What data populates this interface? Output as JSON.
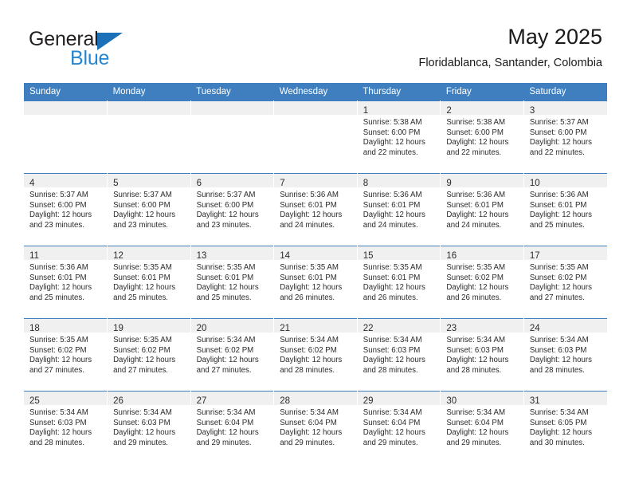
{
  "brand": {
    "name_part1": "General",
    "name_part2": "Blue",
    "triangle_color": "#1c70b8",
    "blue_color": "#2485d0"
  },
  "header": {
    "title": "May 2025",
    "subtitle": "Floridablanca, Santander, Colombia"
  },
  "theme": {
    "header_bg": "#3f7fbf",
    "daynum_bg": "#f0f0f0",
    "cell_bg": "#ffffff",
    "text": "#2b2b2b"
  },
  "calendar": {
    "day_headers": [
      "Sunday",
      "Monday",
      "Tuesday",
      "Wednesday",
      "Thursday",
      "Friday",
      "Saturday"
    ],
    "weeks": [
      [
        {
          "day": "",
          "sunrise": "",
          "sunset": "",
          "daylight_line1": "",
          "daylight_line2": ""
        },
        {
          "day": "",
          "sunrise": "",
          "sunset": "",
          "daylight_line1": "",
          "daylight_line2": ""
        },
        {
          "day": "",
          "sunrise": "",
          "sunset": "",
          "daylight_line1": "",
          "daylight_line2": ""
        },
        {
          "day": "",
          "sunrise": "",
          "sunset": "",
          "daylight_line1": "",
          "daylight_line2": ""
        },
        {
          "day": "1",
          "sunrise": "Sunrise: 5:38 AM",
          "sunset": "Sunset: 6:00 PM",
          "daylight_line1": "Daylight: 12 hours",
          "daylight_line2": "and 22 minutes."
        },
        {
          "day": "2",
          "sunrise": "Sunrise: 5:38 AM",
          "sunset": "Sunset: 6:00 PM",
          "daylight_line1": "Daylight: 12 hours",
          "daylight_line2": "and 22 minutes."
        },
        {
          "day": "3",
          "sunrise": "Sunrise: 5:37 AM",
          "sunset": "Sunset: 6:00 PM",
          "daylight_line1": "Daylight: 12 hours",
          "daylight_line2": "and 22 minutes."
        }
      ],
      [
        {
          "day": "4",
          "sunrise": "Sunrise: 5:37 AM",
          "sunset": "Sunset: 6:00 PM",
          "daylight_line1": "Daylight: 12 hours",
          "daylight_line2": "and 23 minutes."
        },
        {
          "day": "5",
          "sunrise": "Sunrise: 5:37 AM",
          "sunset": "Sunset: 6:00 PM",
          "daylight_line1": "Daylight: 12 hours",
          "daylight_line2": "and 23 minutes."
        },
        {
          "day": "6",
          "sunrise": "Sunrise: 5:37 AM",
          "sunset": "Sunset: 6:00 PM",
          "daylight_line1": "Daylight: 12 hours",
          "daylight_line2": "and 23 minutes."
        },
        {
          "day": "7",
          "sunrise": "Sunrise: 5:36 AM",
          "sunset": "Sunset: 6:01 PM",
          "daylight_line1": "Daylight: 12 hours",
          "daylight_line2": "and 24 minutes."
        },
        {
          "day": "8",
          "sunrise": "Sunrise: 5:36 AM",
          "sunset": "Sunset: 6:01 PM",
          "daylight_line1": "Daylight: 12 hours",
          "daylight_line2": "and 24 minutes."
        },
        {
          "day": "9",
          "sunrise": "Sunrise: 5:36 AM",
          "sunset": "Sunset: 6:01 PM",
          "daylight_line1": "Daylight: 12 hours",
          "daylight_line2": "and 24 minutes."
        },
        {
          "day": "10",
          "sunrise": "Sunrise: 5:36 AM",
          "sunset": "Sunset: 6:01 PM",
          "daylight_line1": "Daylight: 12 hours",
          "daylight_line2": "and 25 minutes."
        }
      ],
      [
        {
          "day": "11",
          "sunrise": "Sunrise: 5:36 AM",
          "sunset": "Sunset: 6:01 PM",
          "daylight_line1": "Daylight: 12 hours",
          "daylight_line2": "and 25 minutes."
        },
        {
          "day": "12",
          "sunrise": "Sunrise: 5:35 AM",
          "sunset": "Sunset: 6:01 PM",
          "daylight_line1": "Daylight: 12 hours",
          "daylight_line2": "and 25 minutes."
        },
        {
          "day": "13",
          "sunrise": "Sunrise: 5:35 AM",
          "sunset": "Sunset: 6:01 PM",
          "daylight_line1": "Daylight: 12 hours",
          "daylight_line2": "and 25 minutes."
        },
        {
          "day": "14",
          "sunrise": "Sunrise: 5:35 AM",
          "sunset": "Sunset: 6:01 PM",
          "daylight_line1": "Daylight: 12 hours",
          "daylight_line2": "and 26 minutes."
        },
        {
          "day": "15",
          "sunrise": "Sunrise: 5:35 AM",
          "sunset": "Sunset: 6:01 PM",
          "daylight_line1": "Daylight: 12 hours",
          "daylight_line2": "and 26 minutes."
        },
        {
          "day": "16",
          "sunrise": "Sunrise: 5:35 AM",
          "sunset": "Sunset: 6:02 PM",
          "daylight_line1": "Daylight: 12 hours",
          "daylight_line2": "and 26 minutes."
        },
        {
          "day": "17",
          "sunrise": "Sunrise: 5:35 AM",
          "sunset": "Sunset: 6:02 PM",
          "daylight_line1": "Daylight: 12 hours",
          "daylight_line2": "and 27 minutes."
        }
      ],
      [
        {
          "day": "18",
          "sunrise": "Sunrise: 5:35 AM",
          "sunset": "Sunset: 6:02 PM",
          "daylight_line1": "Daylight: 12 hours",
          "daylight_line2": "and 27 minutes."
        },
        {
          "day": "19",
          "sunrise": "Sunrise: 5:35 AM",
          "sunset": "Sunset: 6:02 PM",
          "daylight_line1": "Daylight: 12 hours",
          "daylight_line2": "and 27 minutes."
        },
        {
          "day": "20",
          "sunrise": "Sunrise: 5:34 AM",
          "sunset": "Sunset: 6:02 PM",
          "daylight_line1": "Daylight: 12 hours",
          "daylight_line2": "and 27 minutes."
        },
        {
          "day": "21",
          "sunrise": "Sunrise: 5:34 AM",
          "sunset": "Sunset: 6:02 PM",
          "daylight_line1": "Daylight: 12 hours",
          "daylight_line2": "and 28 minutes."
        },
        {
          "day": "22",
          "sunrise": "Sunrise: 5:34 AM",
          "sunset": "Sunset: 6:03 PM",
          "daylight_line1": "Daylight: 12 hours",
          "daylight_line2": "and 28 minutes."
        },
        {
          "day": "23",
          "sunrise": "Sunrise: 5:34 AM",
          "sunset": "Sunset: 6:03 PM",
          "daylight_line1": "Daylight: 12 hours",
          "daylight_line2": "and 28 minutes."
        },
        {
          "day": "24",
          "sunrise": "Sunrise: 5:34 AM",
          "sunset": "Sunset: 6:03 PM",
          "daylight_line1": "Daylight: 12 hours",
          "daylight_line2": "and 28 minutes."
        }
      ],
      [
        {
          "day": "25",
          "sunrise": "Sunrise: 5:34 AM",
          "sunset": "Sunset: 6:03 PM",
          "daylight_line1": "Daylight: 12 hours",
          "daylight_line2": "and 28 minutes."
        },
        {
          "day": "26",
          "sunrise": "Sunrise: 5:34 AM",
          "sunset": "Sunset: 6:03 PM",
          "daylight_line1": "Daylight: 12 hours",
          "daylight_line2": "and 29 minutes."
        },
        {
          "day": "27",
          "sunrise": "Sunrise: 5:34 AM",
          "sunset": "Sunset: 6:04 PM",
          "daylight_line1": "Daylight: 12 hours",
          "daylight_line2": "and 29 minutes."
        },
        {
          "day": "28",
          "sunrise": "Sunrise: 5:34 AM",
          "sunset": "Sunset: 6:04 PM",
          "daylight_line1": "Daylight: 12 hours",
          "daylight_line2": "and 29 minutes."
        },
        {
          "day": "29",
          "sunrise": "Sunrise: 5:34 AM",
          "sunset": "Sunset: 6:04 PM",
          "daylight_line1": "Daylight: 12 hours",
          "daylight_line2": "and 29 minutes."
        },
        {
          "day": "30",
          "sunrise": "Sunrise: 5:34 AM",
          "sunset": "Sunset: 6:04 PM",
          "daylight_line1": "Daylight: 12 hours",
          "daylight_line2": "and 29 minutes."
        },
        {
          "day": "31",
          "sunrise": "Sunrise: 5:34 AM",
          "sunset": "Sunset: 6:05 PM",
          "daylight_line1": "Daylight: 12 hours",
          "daylight_line2": "and 30 minutes."
        }
      ]
    ]
  }
}
